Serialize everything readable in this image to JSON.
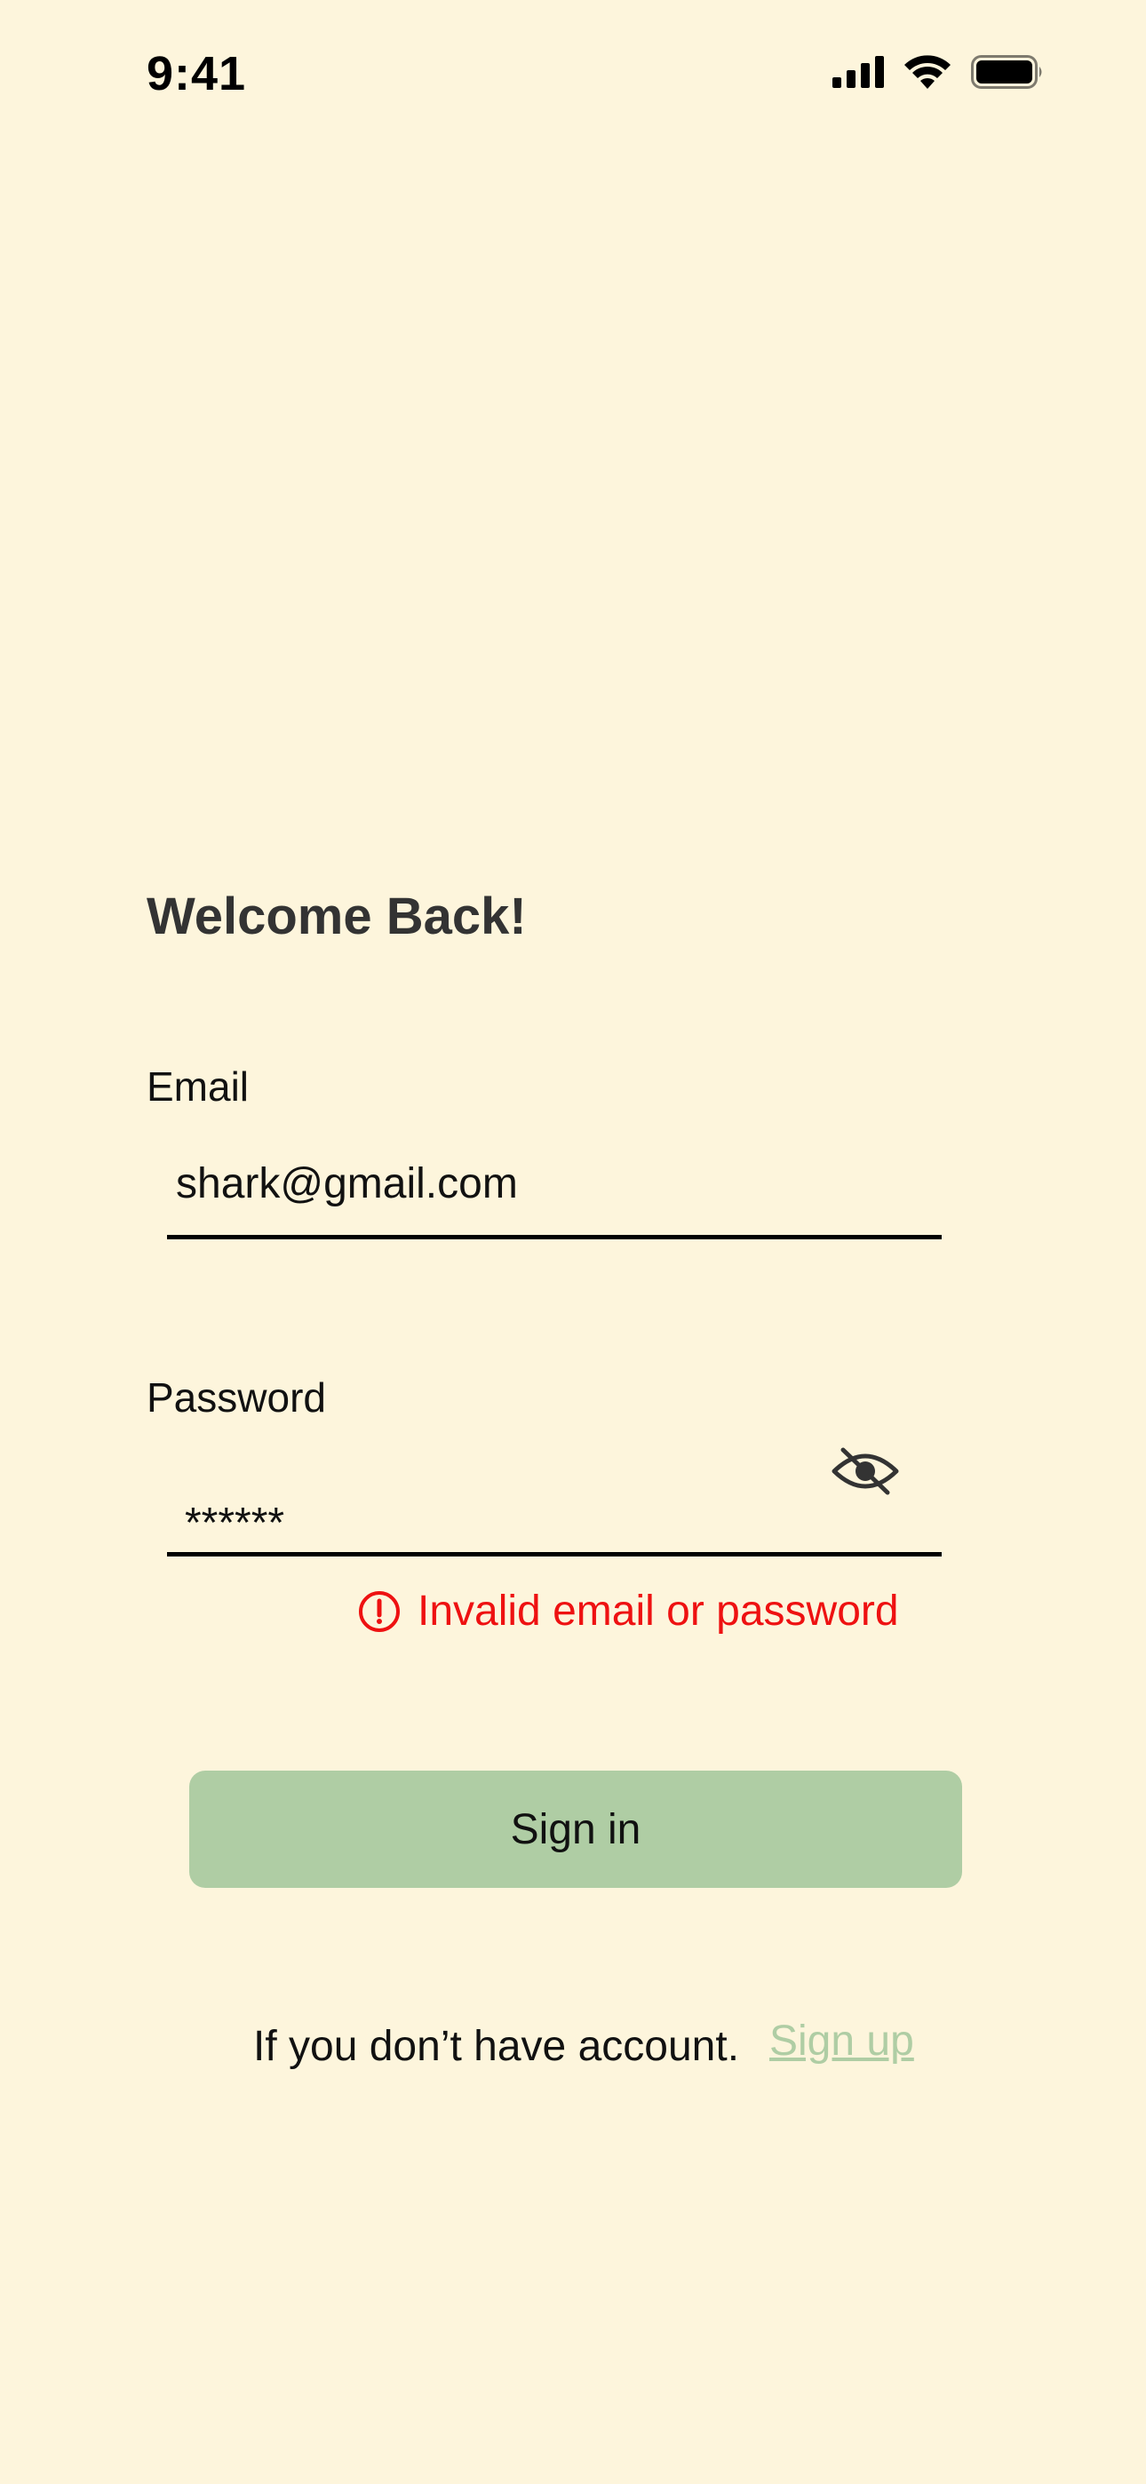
{
  "status_bar": {
    "time": "9:41",
    "icons": [
      "cellular-signal-icon",
      "wifi-icon",
      "battery-icon"
    ]
  },
  "login": {
    "title": "Welcome Back!",
    "email_label": "Email",
    "email_value": "shark@gmail.com",
    "password_label": "Password",
    "password_value": "******",
    "password_toggle_icon": "eye-off-icon",
    "error_icon": "alert-circle-icon",
    "error_message": "Invalid email or password",
    "sign_in_label": "Sign in",
    "signup_prompt": "If you don’t have account.",
    "signup_link": "Sign up"
  },
  "colors": {
    "background": "#FDF5DC",
    "button": "#AFCDA4",
    "link": "#AFCDA4",
    "error": "#EE1111",
    "title": "#333333"
  }
}
